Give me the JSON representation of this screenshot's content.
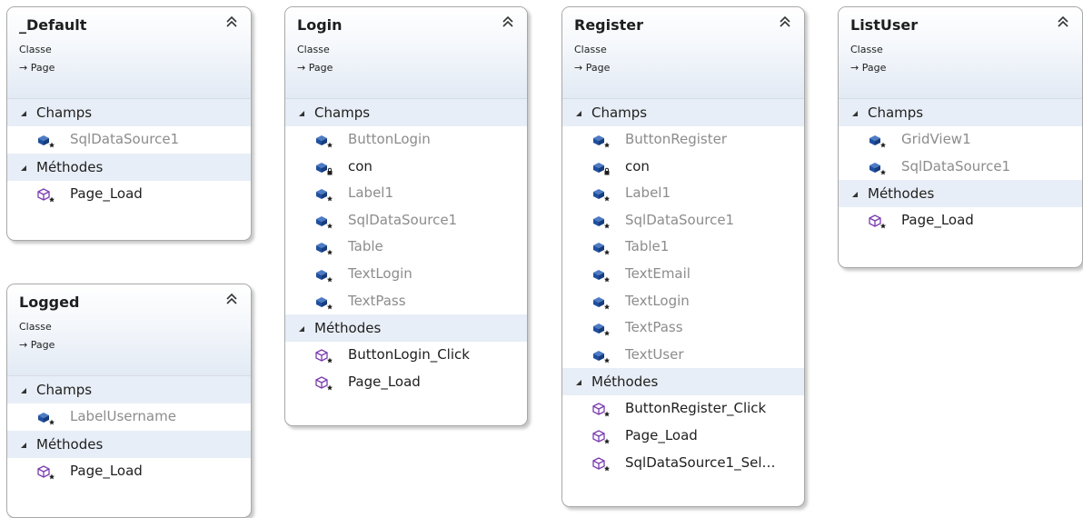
{
  "classes": [
    {
      "id": "default",
      "name": "_Default",
      "kind": "Classe",
      "base": "→ Page",
      "fields_label": "Champs",
      "fields": [
        {
          "name": "SqlDataSource1",
          "access": "protected"
        }
      ],
      "methods_label": "Méthodes",
      "methods": [
        {
          "name": "Page_Load"
        }
      ]
    },
    {
      "id": "logged",
      "name": "Logged",
      "kind": "Classe",
      "base": "→ Page",
      "fields_label": "Champs",
      "fields": [
        {
          "name": "LabelUsername",
          "access": "protected"
        }
      ],
      "methods_label": "Méthodes",
      "methods": [
        {
          "name": "Page_Load"
        }
      ]
    },
    {
      "id": "login",
      "name": "Login",
      "kind": "Classe",
      "base": "→ Page",
      "fields_label": "Champs",
      "fields": [
        {
          "name": "ButtonLogin",
          "access": "protected"
        },
        {
          "name": "con",
          "access": "private"
        },
        {
          "name": "Label1",
          "access": "protected"
        },
        {
          "name": "SqlDataSource1",
          "access": "protected"
        },
        {
          "name": "Table",
          "access": "protected"
        },
        {
          "name": "TextLogin",
          "access": "protected"
        },
        {
          "name": "TextPass",
          "access": "protected"
        }
      ],
      "methods_label": "Méthodes",
      "methods": [
        {
          "name": "ButtonLogin_Click"
        },
        {
          "name": "Page_Load"
        }
      ]
    },
    {
      "id": "register",
      "name": "Register",
      "kind": "Classe",
      "base": "→ Page",
      "fields_label": "Champs",
      "fields": [
        {
          "name": "ButtonRegister",
          "access": "protected"
        },
        {
          "name": "con",
          "access": "private"
        },
        {
          "name": "Label1",
          "access": "protected"
        },
        {
          "name": "SqlDataSource1",
          "access": "protected"
        },
        {
          "name": "Table1",
          "access": "protected"
        },
        {
          "name": "TextEmail",
          "access": "protected"
        },
        {
          "name": "TextLogin",
          "access": "protected"
        },
        {
          "name": "TextPass",
          "access": "protected"
        },
        {
          "name": "TextUser",
          "access": "protected"
        }
      ],
      "methods_label": "Méthodes",
      "methods": [
        {
          "name": "ButtonRegister_Click"
        },
        {
          "name": "Page_Load"
        },
        {
          "name": "SqlDataSource1_Sel…"
        }
      ]
    },
    {
      "id": "listuser",
      "name": "ListUser",
      "kind": "Classe",
      "base": "→ Page",
      "fields_label": "Champs",
      "fields": [
        {
          "name": "GridView1",
          "access": "protected"
        },
        {
          "name": "SqlDataSource1",
          "access": "protected"
        }
      ],
      "methods_label": "Méthodes",
      "methods": [
        {
          "name": "Page_Load"
        }
      ]
    }
  ],
  "colors": {
    "field_icon": "#1f4fa0",
    "method_icon": "#7a3bb0",
    "protected_text": "#8c8c8c",
    "section_bg": "#e8eef7"
  }
}
